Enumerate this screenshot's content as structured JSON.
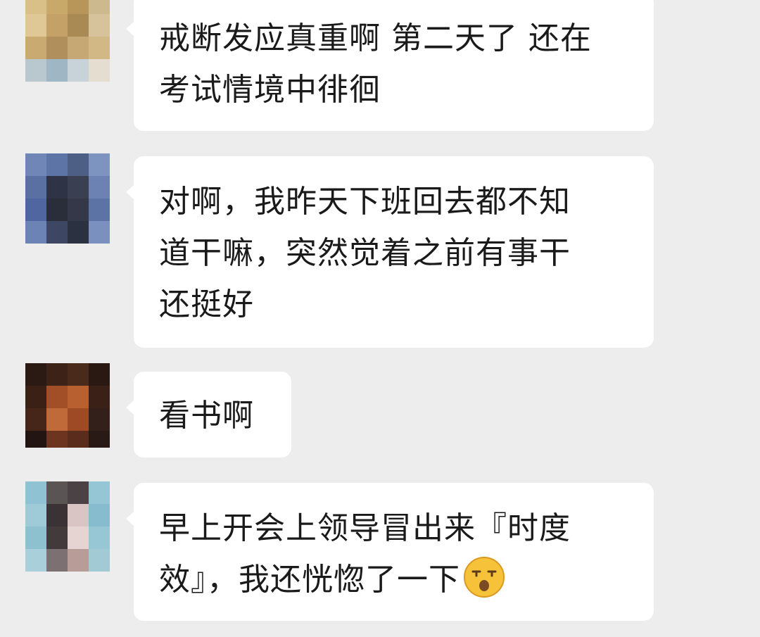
{
  "messages": [
    {
      "avatar": "blurred-avatar-1",
      "line1": "戒断发应真重啊 第二天了 还在",
      "line2": "考试情境中徘徊"
    },
    {
      "avatar": "blurred-avatar-2",
      "line1": "对啊，我昨天下班回去都不知",
      "line2": "道干嘛，突然觉着之前有事干",
      "line3": "还挺好"
    },
    {
      "avatar": "blurred-avatar-3",
      "line1": "看书啊"
    },
    {
      "avatar": "blurred-avatar-4",
      "line1": "早上开会上领导冒出来『时度",
      "line2": "效』，我还恍惚了一下",
      "emoji": "sleepy-face-emoji"
    }
  ],
  "colors": {
    "background": "#ededed",
    "bubble": "#ffffff",
    "text": "#1a1a1a"
  }
}
